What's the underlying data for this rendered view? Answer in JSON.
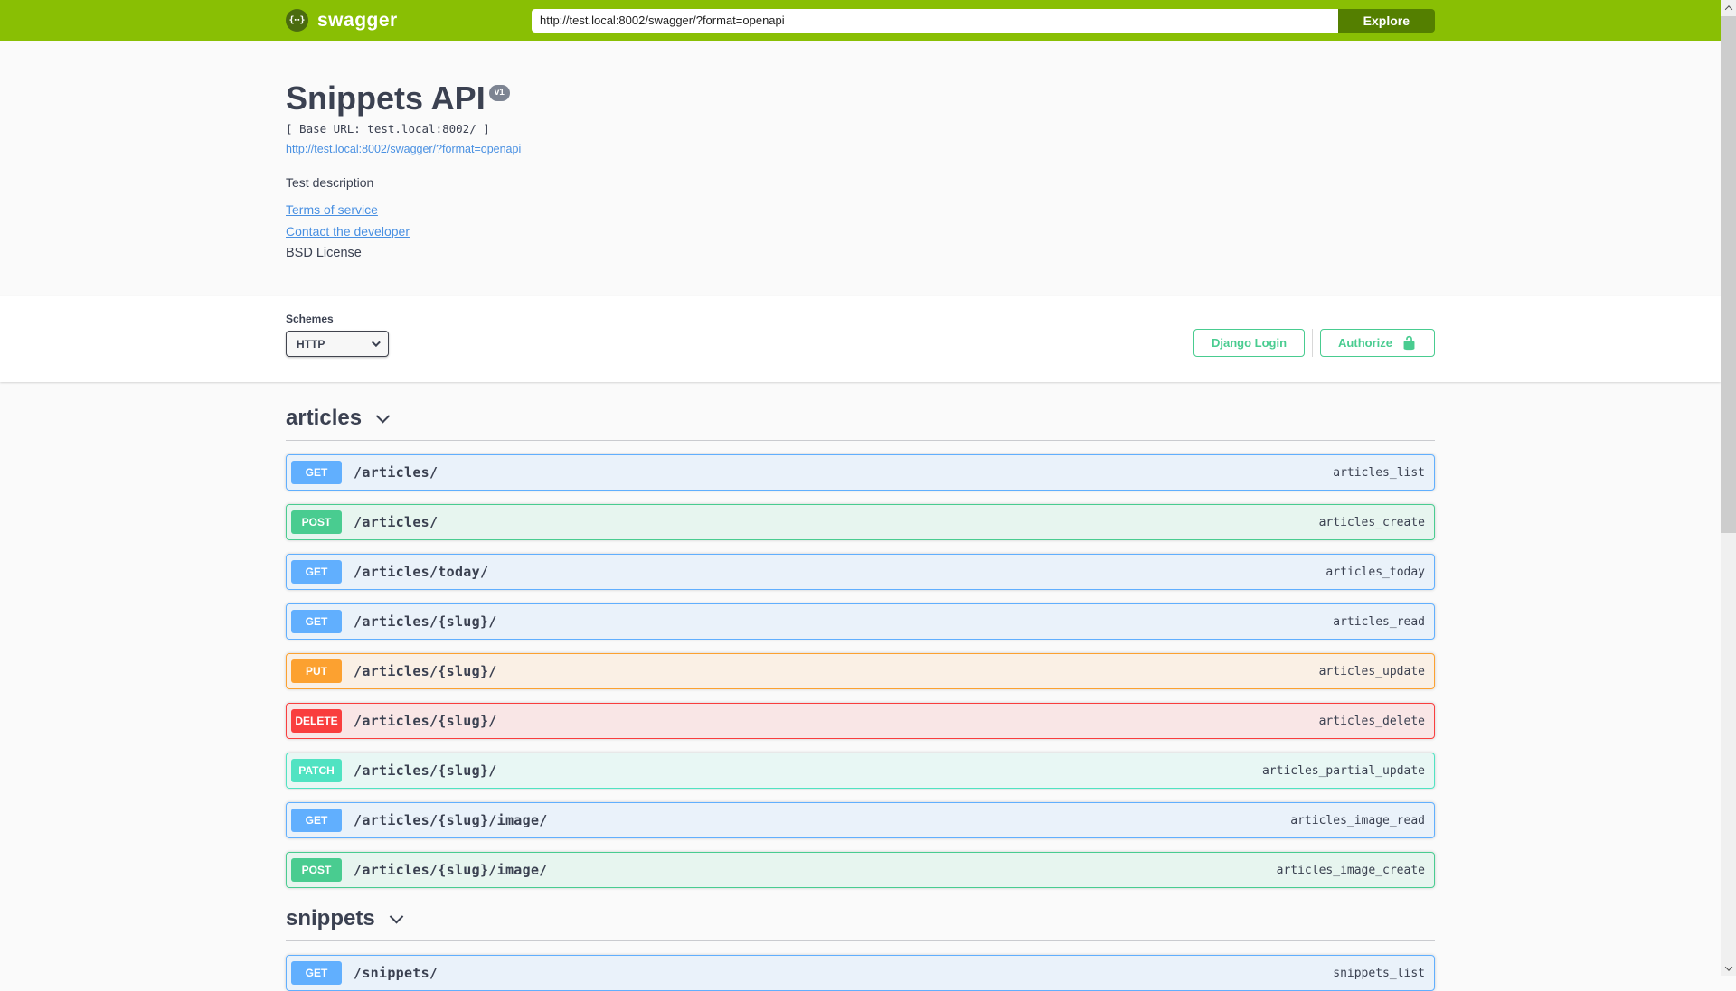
{
  "topbar": {
    "brand": "swagger",
    "logo_glyph": "{⋯}",
    "url_value": "http://test.local:8002/swagger/?format=openapi",
    "explore_label": "Explore"
  },
  "info": {
    "title": "Snippets API",
    "version_badge": "v1",
    "base_url": "[ Base URL: test.local:8002/ ]",
    "spec_link": "http://test.local:8002/swagger/?format=openapi",
    "description": "Test description",
    "terms_link": "Terms of service",
    "contact_link": "Contact the developer",
    "license": "BSD License"
  },
  "scheme": {
    "label": "Schemes",
    "selected": "HTTP",
    "django_login_label": "Django Login",
    "authorize_label": "Authorize"
  },
  "colors": {
    "topbar_green": "#89bf04",
    "explore_green": "#547f00",
    "auth_green": "#49cc90",
    "link_blue": "#4990e2",
    "text_dark": "#3b4151",
    "get": "#61affe",
    "post": "#49cc90",
    "put": "#fca130",
    "delete": "#f93e3e",
    "patch": "#50e3c2"
  },
  "sections": [
    {
      "tag": "articles",
      "operations": [
        {
          "method": "GET",
          "path": "/articles/",
          "operation_id": "articles_list"
        },
        {
          "method": "POST",
          "path": "/articles/",
          "operation_id": "articles_create"
        },
        {
          "method": "GET",
          "path": "/articles/today/",
          "operation_id": "articles_today"
        },
        {
          "method": "GET",
          "path": "/articles/{slug}/",
          "operation_id": "articles_read"
        },
        {
          "method": "PUT",
          "path": "/articles/{slug}/",
          "operation_id": "articles_update"
        },
        {
          "method": "DELETE",
          "path": "/articles/{slug}/",
          "operation_id": "articles_delete"
        },
        {
          "method": "PATCH",
          "path": "/articles/{slug}/",
          "operation_id": "articles_partial_update"
        },
        {
          "method": "GET",
          "path": "/articles/{slug}/image/",
          "operation_id": "articles_image_read"
        },
        {
          "method": "POST",
          "path": "/articles/{slug}/image/",
          "operation_id": "articles_image_create"
        }
      ]
    },
    {
      "tag": "snippets",
      "operations": [
        {
          "method": "GET",
          "path": "/snippets/",
          "operation_id": "snippets_list"
        }
      ]
    }
  ]
}
